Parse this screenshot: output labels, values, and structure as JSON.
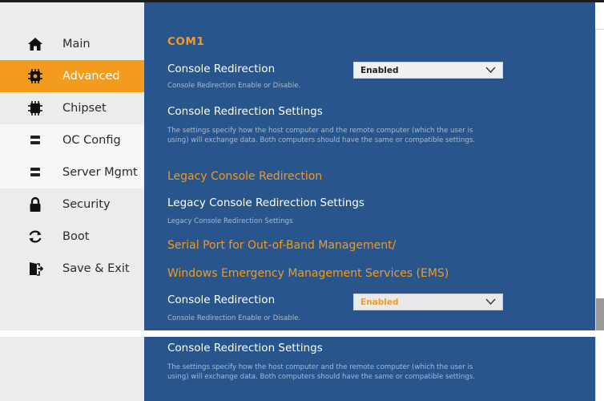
{
  "sidebar": {
    "items": [
      {
        "label": "Main",
        "icon": "home-icon"
      },
      {
        "label": "Advanced",
        "icon": "advanced-chip-icon"
      },
      {
        "label": "Chipset",
        "icon": "chip-icon"
      },
      {
        "label": "OC Config",
        "icon": "server-icon"
      },
      {
        "label": "Server Mgmt",
        "icon": "server-icon"
      },
      {
        "label": "Security",
        "icon": "lock-icon"
      },
      {
        "label": "Boot",
        "icon": "refresh-icon"
      },
      {
        "label": "Save & Exit",
        "icon": "exit-door-icon"
      }
    ],
    "active_item": "Advanced"
  },
  "main": {
    "com1_heading": "COM1",
    "console_redirection_1": {
      "title": "Console Redirection",
      "help": "Console Redirection Enable or Disable.",
      "value": "Enabled"
    },
    "console_settings_1": {
      "title": "Console Redirection Settings",
      "help": "The settings specify how the host computer and the remote computer (which the user is using) will exchange data. Both computers should have the same or compatible settings."
    },
    "legacy_heading": "Legacy Console Redirection",
    "legacy_settings": {
      "title": "Legacy Console Redirection Settings",
      "help": "Legacy Console Redirection Settings"
    },
    "ems_heading_line1": "Serial Port for Out-of-Band Management/",
    "ems_heading_line2": "Windows Emergency Management Services (EMS)",
    "console_redirection_2": {
      "title": "Console Redirection",
      "help": "Console Redirection Enable or Disable.",
      "value": "Enabled"
    }
  },
  "lower": {
    "console_settings_2": {
      "title": "Console Redirection Settings",
      "help": "The settings specify how the host computer and the remote computer (which the user is using) will exchange data. Both computers should have the same or compatible settings."
    }
  },
  "colors": {
    "panel_blue": "#28558c",
    "accent_orange": "#f39b1d",
    "sidebar_gray": "#ececec"
  }
}
